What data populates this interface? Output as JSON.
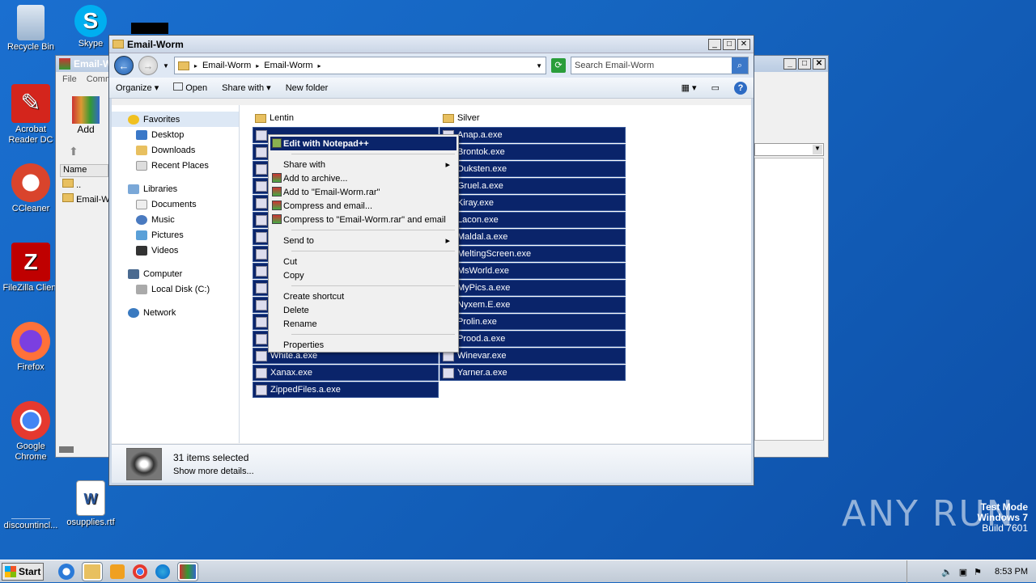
{
  "desktop": {
    "icons": [
      {
        "label": "Recycle Bin",
        "icon": "recycle-bin-icon",
        "color": "#9bb4cf"
      },
      {
        "label": "Skype",
        "icon": "skype-icon",
        "color": "#00aff0"
      },
      {
        "label": "Acrobat Reader DC",
        "icon": "acrobat-icon",
        "color": "#d4251c"
      },
      {
        "label": "CCleaner",
        "icon": "ccleaner-icon",
        "color": "#d9442c"
      },
      {
        "label": "FileZilla Client",
        "icon": "filezilla-icon",
        "color": "#bf0000"
      },
      {
        "label": "Firefox",
        "icon": "firefox-icon",
        "color": "#ff7139"
      },
      {
        "label": "Google Chrome",
        "icon": "chrome-icon",
        "color": "#4285f4"
      },
      {
        "label": "discountincl...",
        "icon": "blank-file-icon",
        "color": "#1565c0"
      },
      {
        "label": "osupplies.rtf",
        "icon": "word-doc-icon",
        "color": "#ffffff"
      }
    ]
  },
  "bg_window": {
    "title": "Email-W",
    "menu": [
      "File",
      "Comm"
    ],
    "add_label": "Add",
    "col_name": "Name",
    "rows": [
      "..",
      "Email-W"
    ]
  },
  "explorer": {
    "title": "Email-Worm",
    "breadcrumb": [
      "Email-Worm",
      "Email-Worm"
    ],
    "search_placeholder": "Search Email-Worm",
    "toolbar": {
      "organize": "Organize",
      "open": "Open",
      "share_with": "Share with",
      "new_folder": "New folder"
    },
    "nav": {
      "favorites": "Favorites",
      "fav_items": [
        "Desktop",
        "Downloads",
        "Recent Places"
      ],
      "libraries": "Libraries",
      "lib_items": [
        "Documents",
        "Music",
        "Pictures",
        "Videos"
      ],
      "computer": "Computer",
      "comp_items": [
        "Local Disk (C:)"
      ],
      "network": "Network"
    },
    "folders": [
      "Lentin",
      "Silver"
    ],
    "files_left": [
      "",
      "",
      "",
      "",
      "",
      "",
      "",
      "",
      "",
      "",
      "",
      "",
      "",
      "White.a.exe",
      "Xanax.exe",
      "ZippedFiles.a.exe"
    ],
    "files_right": [
      "Anap.a.exe",
      "Brontok.exe",
      "Duksten.exe",
      "Gruel.a.exe",
      "Kiray.exe",
      "Lacon.exe",
      "Maldal.a.exe",
      "MeltingScreen.exe",
      "MsWorld.exe",
      "MyPics.a.exe",
      "Nyxem.E.exe",
      "Prolin.exe",
      "Prood.a.exe",
      "Winevar.exe",
      "Yarner.a.exe"
    ],
    "status": {
      "selected": "31 items selected",
      "details": "Show more details..."
    }
  },
  "context_menu": {
    "items": [
      {
        "label": "Edit with Notepad++",
        "highlight": true
      },
      {
        "label": "Share with",
        "submenu": true
      },
      {
        "label": "Add to archive...",
        "icon": true
      },
      {
        "label": "Add to \"Email-Worm.rar\"",
        "icon": true
      },
      {
        "label": "Compress and email...",
        "icon": true
      },
      {
        "label": "Compress to \"Email-Worm.rar\" and email",
        "icon": true
      },
      {
        "label": "Send to",
        "submenu": true
      },
      {
        "label": "Cut"
      },
      {
        "label": "Copy"
      },
      {
        "label": "Create shortcut"
      },
      {
        "label": "Delete"
      },
      {
        "label": "Rename"
      },
      {
        "label": "Properties"
      }
    ]
  },
  "taskbar": {
    "start": "Start",
    "clock": "8:53 PM"
  },
  "watermark": {
    "line1": "Test Mode",
    "line2": "Windows 7",
    "line3": "Build 7601"
  },
  "brand": "ANY RUN"
}
